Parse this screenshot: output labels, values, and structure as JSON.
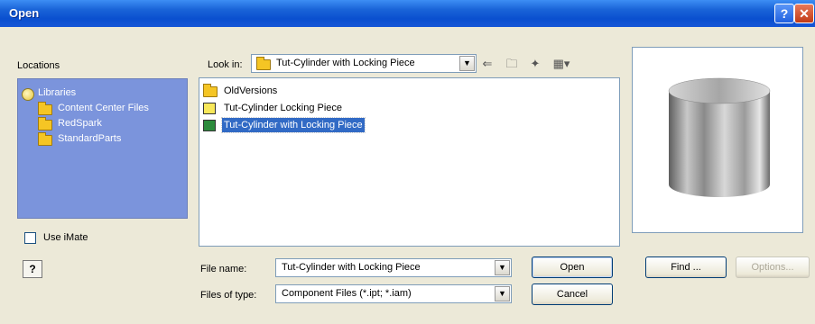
{
  "dialog": {
    "title": "Open"
  },
  "locations": {
    "label": "Locations",
    "items": [
      {
        "label": "Libraries",
        "icon": "libraries-icon"
      },
      {
        "label": "Content Center Files",
        "icon": "folder-icon"
      },
      {
        "label": "RedSpark",
        "icon": "folder-icon"
      },
      {
        "label": "StandardParts",
        "icon": "folder-icon"
      }
    ]
  },
  "use_imate": {
    "label": "Use iMate",
    "checked": false
  },
  "look_in": {
    "label": "Look in:",
    "value": "Tut-Cylinder with Locking Piece"
  },
  "files": [
    {
      "name": "OldVersions",
      "icon": "folder-icon",
      "selected": false
    },
    {
      "name": "Tut-Cylinder Locking Piece",
      "icon": "project-folder-icon",
      "selected": false
    },
    {
      "name": "Tut-Cylinder with Locking Piece",
      "icon": "project-folder-green-icon",
      "selected": true
    }
  ],
  "file_name": {
    "label": "File name:",
    "value": "Tut-Cylinder with Locking Piece"
  },
  "file_type": {
    "label": "Files of type:",
    "value": "Component Files (*.ipt; *.iam)"
  },
  "buttons": {
    "open": "Open",
    "cancel": "Cancel",
    "find": "Find ...",
    "options": "Options..."
  },
  "colors": {
    "titlebar": "#0a4fcf",
    "locations_bg": "#7b94dc",
    "selection": "#316ac5",
    "dialog_bg": "#ece9d8"
  }
}
